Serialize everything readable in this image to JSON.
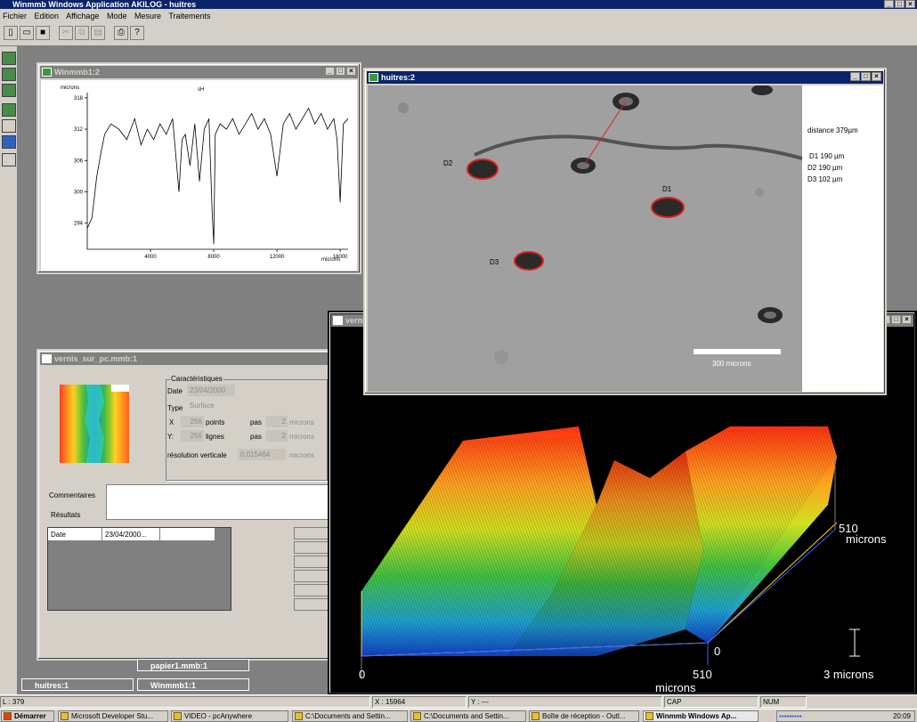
{
  "app": {
    "title": "Winmmb Windows Application AKILOG - huitres",
    "menu": [
      "Fichier",
      "Edition",
      "Affichage",
      "Mode",
      "Mesure",
      "Traitements"
    ]
  },
  "toolbar": {
    "icons": [
      "new-icon",
      "open-icon",
      "save-icon",
      "cut-icon",
      "copy-icon",
      "paste-icon",
      "print-icon",
      "help-icon"
    ]
  },
  "profile_window": {
    "title": "Winmmb1:2",
    "y_unit": "microns",
    "legend": "sH",
    "x_unit": "microns"
  },
  "chart_data": {
    "type": "line",
    "ylabel": "microns",
    "xlabel": "microns",
    "xlim": [
      0,
      16500
    ],
    "ylim": [
      289,
      319
    ],
    "xticks": [
      4000,
      8000,
      12000,
      16000
    ],
    "yticks": [
      294,
      300,
      306,
      312,
      318
    ],
    "series": [
      {
        "name": "sH",
        "x": [
          0,
          300,
          600,
          900,
          1100,
          1500,
          2000,
          2500,
          3000,
          3400,
          3800,
          4200,
          4600,
          5000,
          5400,
          5800,
          6000,
          6200,
          6500,
          6800,
          7100,
          7400,
          7700,
          7900,
          8000,
          8100,
          8400,
          8800,
          9200,
          9600,
          10000,
          10400,
          10800,
          11200,
          11600,
          12000,
          12400,
          12800,
          13200,
          13600,
          14000,
          14400,
          14800,
          15200,
          15600,
          15800,
          16000,
          16200,
          16500
        ],
        "y": [
          293,
          295,
          303,
          308,
          311,
          313,
          312,
          310,
          314,
          309,
          312,
          310,
          313,
          311,
          314,
          300,
          310,
          311,
          305,
          313,
          302,
          312,
          314,
          296,
          290,
          311,
          313,
          312,
          314,
          311,
          313,
          315,
          312,
          314,
          311,
          303,
          313,
          315,
          312,
          314,
          316,
          313,
          315,
          312,
          314,
          310,
          298,
          313,
          314
        ]
      }
    ]
  },
  "image_window": {
    "title": "huitres:2",
    "distance": "distance 379µm",
    "measures": [
      "D1 190 µm",
      "D2 190 µm",
      "D3 102 µm"
    ],
    "labels": [
      "D1",
      "D2",
      "D3"
    ],
    "scale": "300 microns"
  },
  "char_window": {
    "title": "vernis_sur_pc.mmb:1",
    "group_label": "Caractéristiques",
    "date_label": "Date",
    "date_value": "23/04/2000",
    "type_label": "Type",
    "type_value": "Surface",
    "x_label": "X",
    "x_value": "256",
    "x_unit_label": "points",
    "y_label": "Y:",
    "y_value": "256",
    "y_unit_label": "lignes",
    "pas_label": "pas",
    "pas_value": "2",
    "microns": "microns",
    "res_label": "résolution verticale",
    "res_value": "0.015464",
    "comments_label": "Commentaires",
    "results_label": "Résultats",
    "grid_date_label": "Date",
    "grid_date_value": "23/04/2000..."
  },
  "surface3d_window": {
    "title": "verni",
    "x_min": "0",
    "x_max": "510",
    "x_unit": "microns",
    "y_max": "510",
    "y_unit": "microns",
    "z_min": "0",
    "z_scale": "3 microns"
  },
  "minimized": [
    {
      "label": "papier1.mmb:1"
    },
    {
      "label": "huitres:1"
    },
    {
      "label": "Winmmb1:1"
    }
  ],
  "status": {
    "l": "L : 379",
    "x": "X : 15964",
    "y": "Y : ---",
    "cap": "CAP",
    "num": "NUM"
  },
  "taskbar": {
    "start": "Démarrer",
    "items": [
      "Microsoft Developer Stu...",
      "VIDEO - pcAnywhere",
      "C:\\Documents and Settin...",
      "C:\\Documents and Settin...",
      "Boîte de réception - Outl...",
      "Winmmb Windows Ap..."
    ],
    "clock": "20:09"
  }
}
